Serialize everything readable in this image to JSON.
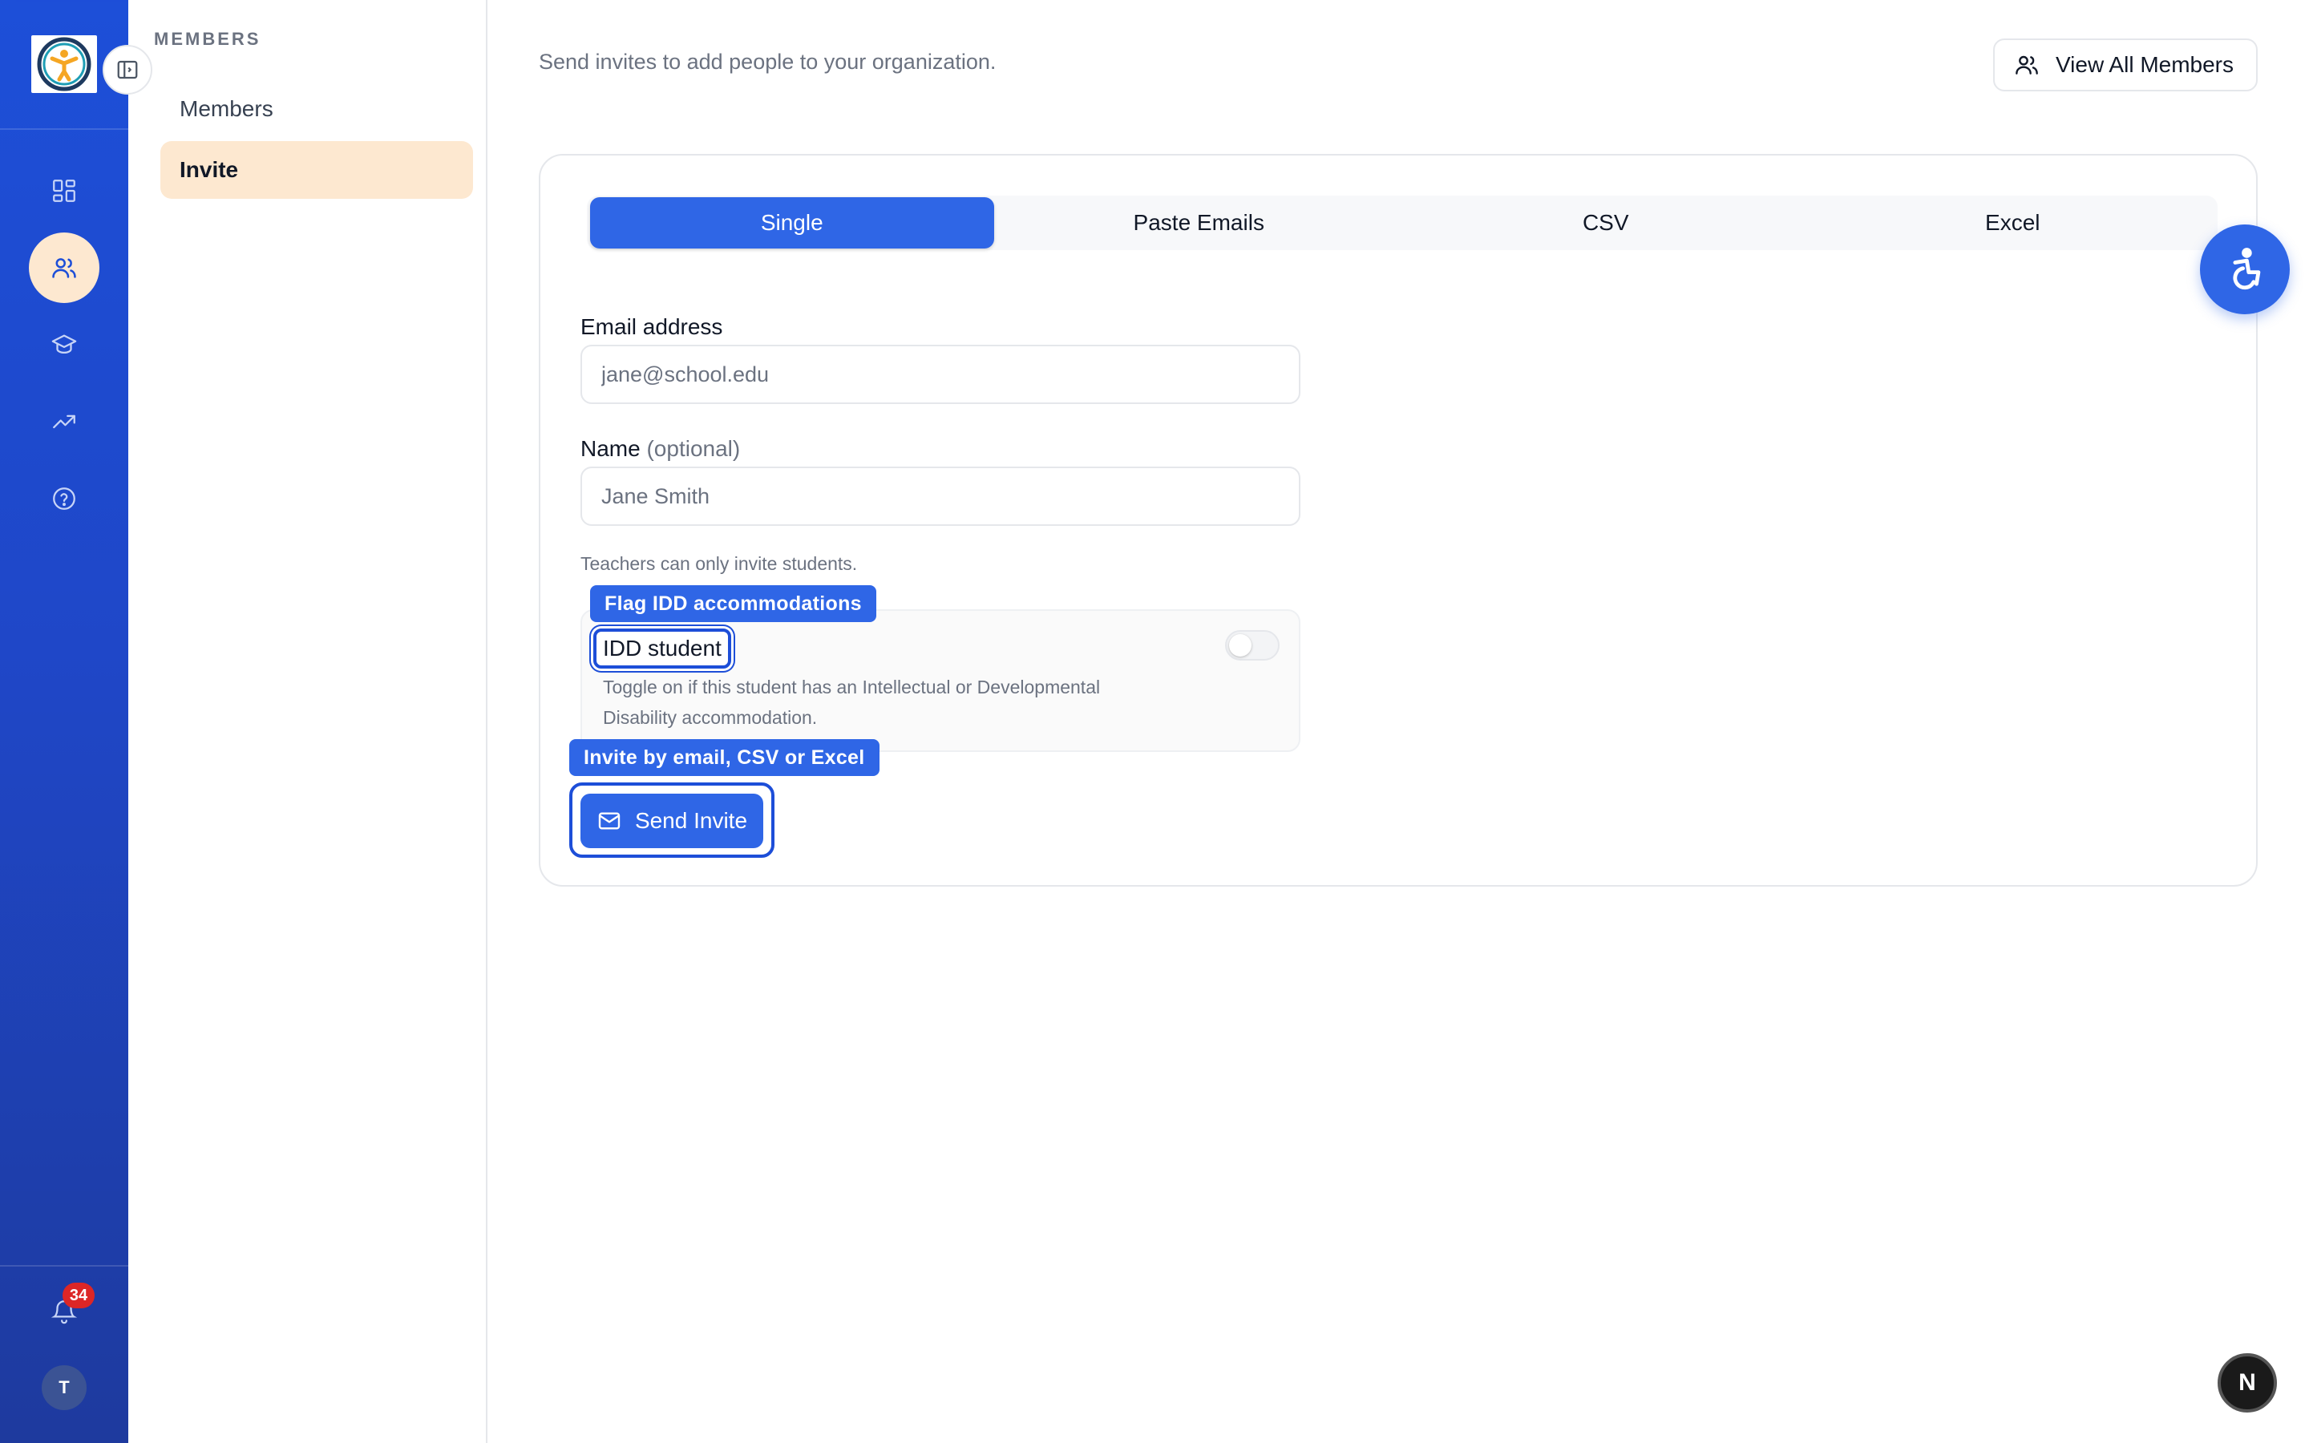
{
  "sidebar_rail": {
    "notifications_count": "34",
    "avatar_initial": "T",
    "items": [
      {
        "icon": "dashboard-grid-icon"
      },
      {
        "icon": "members-icon",
        "active": true
      },
      {
        "icon": "graduation-cap-icon"
      },
      {
        "icon": "trending-up-icon"
      },
      {
        "icon": "help-circle-icon"
      }
    ]
  },
  "submenu": {
    "heading": "MEMBERS",
    "items": [
      {
        "label": "Members"
      },
      {
        "label": "Invite",
        "active": true
      }
    ]
  },
  "header": {
    "subtitle": "Send invites to add people to your organization.",
    "view_all_label": "View All Members"
  },
  "tabs": [
    {
      "label": "Single",
      "active": true
    },
    {
      "label": "Paste Emails"
    },
    {
      "label": "CSV"
    },
    {
      "label": "Excel"
    }
  ],
  "form": {
    "email_label": "Email address",
    "email_placeholder": "jane@school.edu",
    "name_label": "Name",
    "name_optional": "(optional)",
    "name_placeholder": "Jane Smith",
    "hint": "Teachers can only invite students.",
    "idd_title": "IDD student",
    "idd_desc": "Toggle on if this student has an Intellectual or Developmental Disability accommodation.",
    "idd_enabled": false,
    "send_label": "Send Invite"
  },
  "tooltips": {
    "idd": "Flag IDD accommodations",
    "send": "Invite by email, CSV or Excel"
  },
  "fab": {
    "next_letter": "N"
  },
  "colors": {
    "primary": "#2f66e6",
    "rail": "#1d4fd8",
    "active_submenu": "#fde8d0",
    "badge": "#dc2626"
  }
}
